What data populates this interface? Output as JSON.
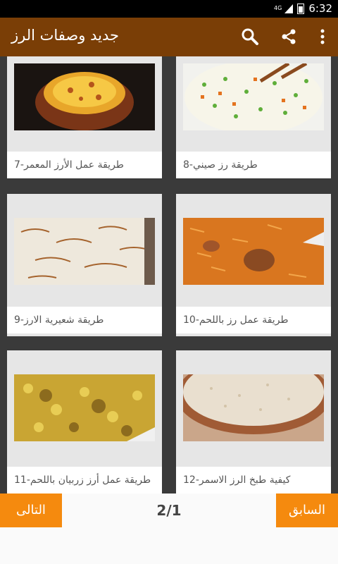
{
  "status_bar": {
    "network": "4G",
    "time": "6:32"
  },
  "app_bar": {
    "title": "جديد وصفات الرز",
    "icons": [
      "search-icon",
      "share-icon",
      "overflow-menu-icon"
    ]
  },
  "recipes": [
    {
      "caption": "7-طريقة عمل الأرز المعمر",
      "image": "baked-rice-clay-pot"
    },
    {
      "caption": "8-طريقة رز صيني",
      "image": "chinese-fried-rice"
    },
    {
      "caption": "9-طريقة شعيرية الارز",
      "image": "vermicelli-rice"
    },
    {
      "caption": "10-طريقة عمل رز باللحم",
      "image": "rice-with-meat"
    },
    {
      "caption": "11-طريقة عمل أرز زربيان باللحم",
      "image": "zurbian-rice"
    },
    {
      "caption": "12-كيفية طبخ الرز الاسمر",
      "image": "brown-rice-bowl"
    }
  ],
  "pagination": {
    "previous_label": "السابق",
    "next_label": "التالى",
    "page_indicator": "2/1"
  },
  "colors": {
    "app_bar": "#7a3e06",
    "accent": "#f58a0e"
  }
}
